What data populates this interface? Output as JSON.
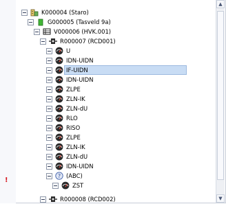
{
  "tree": {
    "nodes": [
      {
        "label": "K000004 (Staro)",
        "icon": "building-icon"
      },
      {
        "label": "G000005 (Tasveld 9a)",
        "icon": "green-block-icon"
      },
      {
        "label": "V000006 (HVK.001)",
        "icon": "rack-icon"
      },
      {
        "label": "R000007 (RCD001)",
        "icon": "breaker-icon"
      },
      {
        "label": "U",
        "icon": "meter-icon"
      },
      {
        "label": "IDN-UIDN",
        "icon": "meter-icon"
      },
      {
        "label": "IF-UIDN",
        "icon": "meter-icon",
        "selected": true
      },
      {
        "label": "IDN-UIDN",
        "icon": "meter-icon"
      },
      {
        "label": "ZLPE",
        "icon": "meter-icon"
      },
      {
        "label": "ZLN-IK",
        "icon": "meter-icon"
      },
      {
        "label": "ZLN-dU",
        "icon": "meter-icon"
      },
      {
        "label": "RLO",
        "icon": "meter-icon"
      },
      {
        "label": "RISO",
        "icon": "meter-icon"
      },
      {
        "label": "ZLPE",
        "icon": "meter-icon"
      },
      {
        "label": "ZLN-IK",
        "icon": "meter-icon"
      },
      {
        "label": "ZLN-dU",
        "icon": "meter-icon"
      },
      {
        "label": "IDN-UIDN",
        "icon": "meter-icon"
      },
      {
        "label": "(ABC)",
        "icon": "question-icon"
      },
      {
        "label": "ZST",
        "icon": "meter-icon"
      },
      {
        "label": "R000008 (RCD002)",
        "icon": "breaker-icon"
      }
    ],
    "warning_glyph": "!"
  },
  "colors": {
    "selection": "#c8dcf4",
    "warning": "#d6171f"
  }
}
